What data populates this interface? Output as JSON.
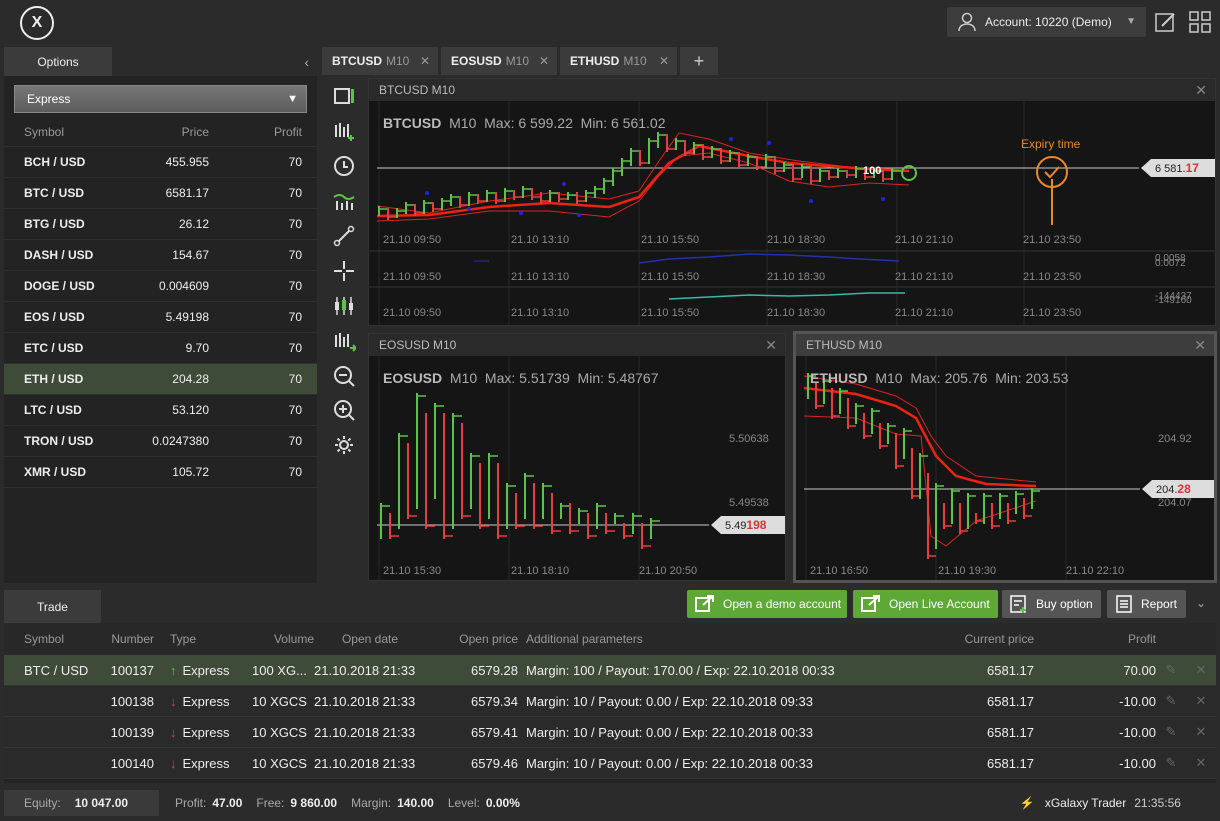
{
  "header": {
    "logo_text": "X",
    "account_label": "Account: 10220 (Demo)"
  },
  "options_panel": {
    "tab_label": "Options",
    "select_value": "Express",
    "columns": {
      "symbol": "Symbol",
      "price": "Price",
      "profit": "Profit"
    },
    "rows": [
      {
        "symbol": "BCH / USD",
        "price": "455.955",
        "profit": "70"
      },
      {
        "symbol": "BTC / USD",
        "price": "6581.17",
        "profit": "70"
      },
      {
        "symbol": "BTG / USD",
        "price": "26.12",
        "profit": "70"
      },
      {
        "symbol": "DASH / USD",
        "price": "154.67",
        "profit": "70"
      },
      {
        "symbol": "DOGE / USD",
        "price": "0.004609",
        "profit": "70"
      },
      {
        "symbol": "EOS / USD",
        "price": "5.49198",
        "profit": "70"
      },
      {
        "symbol": "ETC / USD",
        "price": "9.70",
        "profit": "70"
      },
      {
        "symbol": "ETH / USD",
        "price": "204.28",
        "profit": "70"
      },
      {
        "symbol": "LTC / USD",
        "price": "53.120",
        "profit": "70"
      },
      {
        "symbol": "TRON / USD",
        "price": "0.0247380",
        "profit": "70"
      },
      {
        "symbol": "XMR / USD",
        "price": "105.72",
        "profit": "70"
      }
    ]
  },
  "chart_tabs": [
    {
      "symbol": "BTCUSD",
      "tf": "M10"
    },
    {
      "symbol": "EOSUSD",
      "tf": "M10"
    },
    {
      "symbol": "ETHUSD",
      "tf": "M10"
    }
  ],
  "btc_chart": {
    "title": "BTCUSD M10",
    "symbol": "BTCUSD",
    "tf": "M10",
    "max": "Max: 6 599.22",
    "min": "Min: 6 561.02",
    "price_main": "6 581.",
    "price_red": "17",
    "expiry": "Expiry time",
    "marker": "100",
    "x_labels": [
      "21.10 09:50",
      "21.10 13:10",
      "21.10 15:50",
      "21.10 18:30",
      "21.10 21:10",
      "21.10 23:50"
    ],
    "ind1_a": "0.0058",
    "ind1_b": "0.0072",
    "ind2_a": "-144437",
    "ind2_b": "-149160"
  },
  "eos_chart": {
    "title": "EOSUSD M10",
    "symbol": "EOSUSD",
    "tf": "M10",
    "max": "Max: 5.51739",
    "min": "Min: 5.48767",
    "y_hi": "5.50638",
    "y_lo": "5.49538",
    "price_main": "5.49",
    "price_red": "198",
    "x_labels": [
      "21.10 15:30",
      "21.10 18:10",
      "21.10 20:50"
    ]
  },
  "eth_chart": {
    "title": "ETHUSD M10",
    "symbol": "ETHUSD",
    "tf": "M10",
    "max": "Max: 205.76",
    "min": "Min: 203.53",
    "y_hi": "204.92",
    "y_lo": "204.07",
    "price_main": "204.",
    "price_red": "28",
    "x_labels": [
      "21.10 16:50",
      "21.10 19:30",
      "21.10 22:10"
    ]
  },
  "trade": {
    "tab_label": "Trade",
    "buttons": {
      "demo": "Open a demo account",
      "live": "Open Live Account",
      "buy": "Buy option",
      "report": "Report"
    },
    "columns": {
      "symbol": "Symbol",
      "number": "Number",
      "type": "Type",
      "volume": "Volume",
      "open_date": "Open date",
      "open_price": "Open price",
      "params": "Additional parameters",
      "current": "Current price",
      "profit": "Profit"
    },
    "rows": [
      {
        "symbol": "BTC / USD",
        "number": "100137",
        "dir": "up",
        "type": "Express",
        "volume": "100 XG...",
        "date": "21.10.2018 21:33",
        "price": "6579.28",
        "params": "Margin: 100 / Payout: 170.00 / Exp: 22.10.2018 00:33",
        "current": "6581.17",
        "profit": "70.00"
      },
      {
        "symbol": "",
        "number": "100138",
        "dir": "down",
        "type": "Express",
        "volume": "10 XGCS",
        "date": "21.10.2018 21:33",
        "price": "6579.34",
        "params": "Margin: 10 / Payout: 0.00 / Exp: 22.10.2018 09:33",
        "current": "6581.17",
        "profit": "-10.00"
      },
      {
        "symbol": "",
        "number": "100139",
        "dir": "down",
        "type": "Express",
        "volume": "10 XGCS",
        "date": "21.10.2018 21:33",
        "price": "6579.41",
        "params": "Margin: 10 / Payout: 0.00 / Exp: 22.10.2018 00:33",
        "current": "6581.17",
        "profit": "-10.00"
      },
      {
        "symbol": "",
        "number": "100140",
        "dir": "down",
        "type": "Express",
        "volume": "10 XGCS",
        "date": "21.10.2018 21:33",
        "price": "6579.46",
        "params": "Margin: 10 / Payout: 0.00 / Exp: 22.10.2018 00:33",
        "current": "6581.17",
        "profit": "-10.00"
      }
    ]
  },
  "status": {
    "equity_label": "Equity:",
    "equity": "10 047.00",
    "profit_label": "Profit:",
    "profit": "47.00",
    "free_label": "Free:",
    "free": "9 860.00",
    "margin_label": "Margin:",
    "margin": "140.00",
    "level_label": "Level:",
    "level": "0.00%",
    "app_name": "xGalaxy Trader",
    "time": "21:35:56"
  },
  "colors": {
    "up": "#5ec24a",
    "down": "#e04040",
    "accent_green": "#5ea836",
    "selected_row": "#3d4b38",
    "expiry": "#e8892a"
  }
}
